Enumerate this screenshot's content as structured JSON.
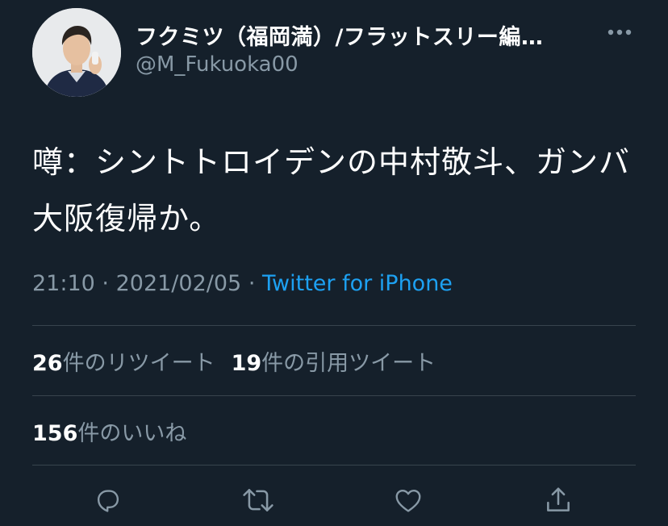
{
  "user": {
    "display_name": "フクミツ（福岡満）/フラットスリー編…",
    "handle": "@M_Fukuoka00"
  },
  "tweet": {
    "text": "噂：シントトロイデンの中村敬斗、ガンバ大阪復帰か。",
    "time": "21:10",
    "separator": "·",
    "date": "2021/02/05",
    "source": "Twitter for iPhone"
  },
  "stats": {
    "retweets_count": "26",
    "retweets_label": "件のリツイート",
    "quotes_count": "19",
    "quotes_label": "件の引用ツイート",
    "likes_count": "156",
    "likes_label": "件のいいね"
  },
  "actions": {
    "icons": [
      "reply-icon",
      "retweet-icon",
      "like-icon",
      "share-icon"
    ]
  },
  "colors": {
    "background": "#15202b",
    "text_primary": "#ffffff",
    "text_secondary": "#8899a6",
    "link": "#1da1f2",
    "divider": "#38444d"
  }
}
